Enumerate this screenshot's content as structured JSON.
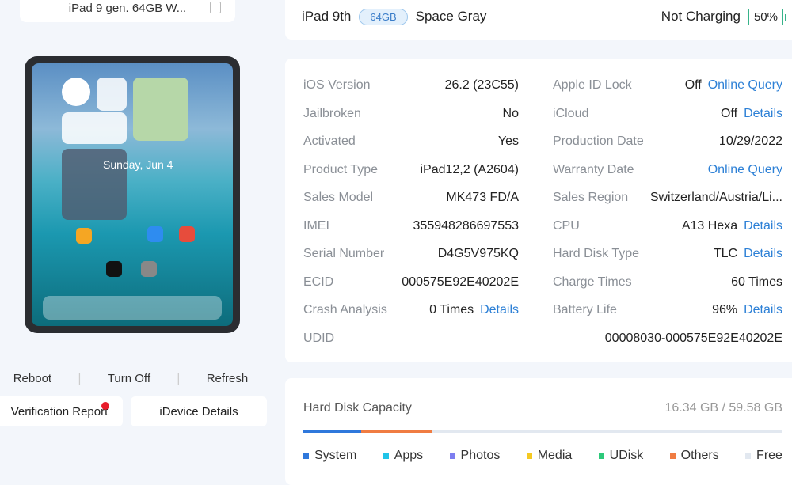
{
  "device_name": "iPad 9 gen. 64GB W...",
  "screen": {
    "date": "Sunday, Jun 4"
  },
  "actions": {
    "reboot": "Reboot",
    "turn_off": "Turn Off",
    "refresh": "Refresh"
  },
  "buttons": {
    "verification": "Verification Report",
    "idevice": "iDevice Details"
  },
  "header": {
    "model": "iPad 9th",
    "capacity": "64GB",
    "color": "Space Gray",
    "charging": "Not Charging",
    "battery": "50%"
  },
  "info_left": [
    {
      "label": "iOS Version",
      "value": "26.2 (23C55)"
    },
    {
      "label": "Jailbroken",
      "value": "No"
    },
    {
      "label": "Activated",
      "value": "Yes"
    },
    {
      "label": "Product Type",
      "value": "iPad12,2 (A2604)"
    },
    {
      "label": "Sales Model",
      "value": "MK473 FD/A"
    },
    {
      "label": "IMEI",
      "value": "355948286697553"
    },
    {
      "label": "Serial Number",
      "value": "D4G5V975KQ"
    },
    {
      "label": "ECID",
      "value": "000575E92E40202E"
    },
    {
      "label": "Crash Analysis",
      "value": "0 Times",
      "link": "Details"
    }
  ],
  "info_right": [
    {
      "label": "Apple ID Lock",
      "value": "Off",
      "link": "Online Query"
    },
    {
      "label": "iCloud",
      "value": "Off",
      "link": "Details"
    },
    {
      "label": "Production Date",
      "value": "10/29/2022"
    },
    {
      "label": "Warranty Date",
      "value": "",
      "link": "Online Query"
    },
    {
      "label": "Sales Region",
      "value": "Switzerland/Austria/Li..."
    },
    {
      "label": "CPU",
      "value": "A13 Hexa",
      "link": "Details"
    },
    {
      "label": "Hard Disk Type",
      "value": "TLC",
      "link": "Details"
    },
    {
      "label": "Charge Times",
      "value": "60 Times"
    },
    {
      "label": "Battery Life",
      "value": "96%",
      "link": "Details"
    }
  ],
  "udid": {
    "label": "UDID",
    "value": "00008030-000575E92E40202E"
  },
  "disk": {
    "title": "Hard Disk Capacity",
    "size": "16.34 GB / 59.58 GB",
    "usage_percent": {
      "System": 12,
      "Others": 15
    },
    "legend": [
      {
        "label": "System",
        "color": "#2f78dc"
      },
      {
        "label": "Apps",
        "color": "#20c4e8"
      },
      {
        "label": "Photos",
        "color": "#7d7ef0"
      },
      {
        "label": "Media",
        "color": "#f5c922"
      },
      {
        "label": "UDisk",
        "color": "#2dc97a"
      },
      {
        "label": "Others",
        "color": "#f07c42"
      },
      {
        "label": "Free",
        "color": "#e2e8f0"
      }
    ]
  }
}
